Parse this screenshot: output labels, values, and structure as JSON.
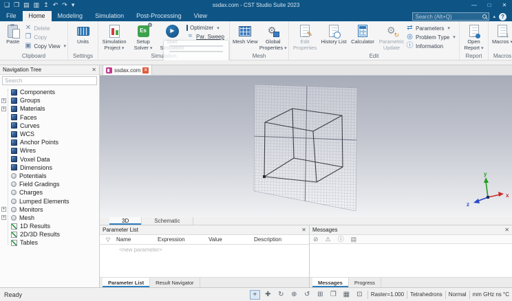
{
  "title_bar": {
    "title": "ssdax.com - CST Studio Suite 2023",
    "quick_access": [
      {
        "glyph": "❏",
        "name": "new-file-icon"
      },
      {
        "glyph": "❐",
        "name": "open-file-icon"
      },
      {
        "glyph": "▤",
        "name": "save-icon"
      },
      {
        "glyph": "▥",
        "name": "save-as-icon"
      },
      {
        "glyph": "↥",
        "name": "import-export-icon"
      },
      {
        "glyph": "↶",
        "name": "undo-icon"
      },
      {
        "glyph": "↷",
        "name": "redo-icon"
      },
      {
        "glyph": "▾",
        "name": "customize-quick-access-icon"
      }
    ],
    "window_controls": [
      {
        "glyph": "—",
        "name": "minimize-button"
      },
      {
        "glyph": "□",
        "name": "maximize-button"
      },
      {
        "glyph": "✕",
        "name": "close-button"
      }
    ]
  },
  "menu_bar": {
    "tabs": [
      {
        "label": "File",
        "state": ""
      },
      {
        "label": "Home",
        "state": "active"
      },
      {
        "label": "Modeling",
        "state": ""
      },
      {
        "label": "Simulation",
        "state": ""
      },
      {
        "label": "Post-Processing",
        "state": ""
      },
      {
        "label": "View",
        "state": ""
      }
    ],
    "search_placeholder": "Search (Alt+Q)",
    "collapse_glyph": "▴",
    "help_glyph": "?"
  },
  "ribbon": {
    "clipboard": {
      "label": "Clipboard",
      "paste": "Paste",
      "del": "Delete",
      "copy": "Copy",
      "copy_view": "Copy View"
    },
    "settings": {
      "label": "Settings",
      "units": "Units"
    },
    "simulation": {
      "label": "Simulation",
      "project": "Simulation Project",
      "solver": "Setup Solver",
      "solver_badge": "Es",
      "start": "Start Simulation",
      "optimizer": "Optimizer",
      "par_sweep": "Par. Sweep"
    },
    "mesh": {
      "label": "Mesh",
      "mesh_view": "Mesh View",
      "global_props": "Global Properties"
    },
    "edit": {
      "label": "Edit",
      "edit_props": "Edit Properties",
      "history": "History List",
      "calculator": "Calculator",
      "parametric": "Parametric Update",
      "parameters": "Parameters",
      "problem": "Problem Type",
      "information": "Information"
    },
    "report": {
      "label": "Report",
      "open_report": "Open Report"
    },
    "macros": {
      "label": "Macros",
      "macros": "Macros"
    }
  },
  "doc_tabs": {
    "active_tab": "ssdax.com"
  },
  "nav_tree": {
    "title": "Navigation Tree",
    "search_placeholder": "Search",
    "items": [
      {
        "label": "Components",
        "icon": "cube",
        "expand": false
      },
      {
        "label": "Groups",
        "icon": "cube",
        "expand": true
      },
      {
        "label": "Materials",
        "icon": "cube",
        "expand": true
      },
      {
        "label": "Faces",
        "icon": "cube",
        "expand": false
      },
      {
        "label": "Curves",
        "icon": "cube",
        "expand": false
      },
      {
        "label": "WCS",
        "icon": "cube",
        "expand": false
      },
      {
        "label": "Anchor Points",
        "icon": "cube",
        "expand": false
      },
      {
        "label": "Wires",
        "icon": "cube",
        "expand": false
      },
      {
        "label": "Voxel Data",
        "icon": "cube",
        "expand": false
      },
      {
        "label": "Dimensions",
        "icon": "cube",
        "expand": false
      },
      {
        "label": "Potentials",
        "icon": "circle",
        "expand": false
      },
      {
        "label": "Field Gradings",
        "icon": "circle",
        "expand": false
      },
      {
        "label": "Charges",
        "icon": "circle",
        "expand": false
      },
      {
        "label": "Lumped Elements",
        "icon": "circle",
        "expand": false
      },
      {
        "label": "Monitors",
        "icon": "circle",
        "expand": true
      },
      {
        "label": "Mesh",
        "icon": "circle",
        "expand": true
      },
      {
        "label": "1D Results",
        "icon": "chart",
        "expand": false
      },
      {
        "label": "2D/3D Results",
        "icon": "chart",
        "expand": false
      },
      {
        "label": "Tables",
        "icon": "chart",
        "expand": false
      }
    ]
  },
  "view_tabs": [
    {
      "label": "3D",
      "state": "active"
    },
    {
      "label": "Schematic",
      "state": ""
    }
  ],
  "parameter_list": {
    "title": "Parameter List",
    "columns": {
      "name": "Name",
      "expression": "Expression",
      "value": "Value",
      "description": "Description"
    },
    "placeholder_row": "<new parameter>",
    "tabs": [
      {
        "label": "Parameter List",
        "state": "active"
      },
      {
        "label": "Result Navigator",
        "state": ""
      }
    ]
  },
  "messages": {
    "title": "Messages",
    "toolbar": [
      {
        "glyph": "⊘",
        "name": "errors-filter-icon"
      },
      {
        "glyph": "⚠",
        "name": "warnings-filter-icon"
      },
      {
        "glyph": "ⓘ",
        "name": "info-filter-icon"
      },
      {
        "glyph": "▤",
        "name": "message-options-icon"
      }
    ],
    "tabs": [
      {
        "label": "Messages",
        "state": "active"
      },
      {
        "label": "Progress",
        "state": ""
      }
    ]
  },
  "status_bar": {
    "ready": "Ready",
    "tools": [
      {
        "glyph": "⌖",
        "name": "zoom-select-icon",
        "state": "active"
      },
      {
        "glyph": "✚",
        "name": "pan-icon",
        "state": ""
      },
      {
        "glyph": "↻",
        "name": "rotate-icon",
        "state": ""
      },
      {
        "glyph": "⊕",
        "name": "dynamic-zoom-icon",
        "state": ""
      },
      {
        "glyph": "↺",
        "name": "rotate-in-plane-icon",
        "state": ""
      },
      {
        "glyph": "⊞",
        "name": "zoom-to-selection-icon",
        "state": ""
      },
      {
        "glyph": "❐",
        "name": "split-view-icon",
        "state": ""
      },
      {
        "glyph": "▦",
        "name": "bounding-box-icon",
        "state": ""
      },
      {
        "glyph": "⊡",
        "name": "fullscreen-icon",
        "state": ""
      }
    ],
    "raster": "Raster=1.000",
    "mesh_type": "Tetrahedrons",
    "render_mode": "Normal",
    "units": "mm GHz ns °C"
  },
  "axes": {
    "x": "x",
    "y": "y",
    "z": "z"
  }
}
